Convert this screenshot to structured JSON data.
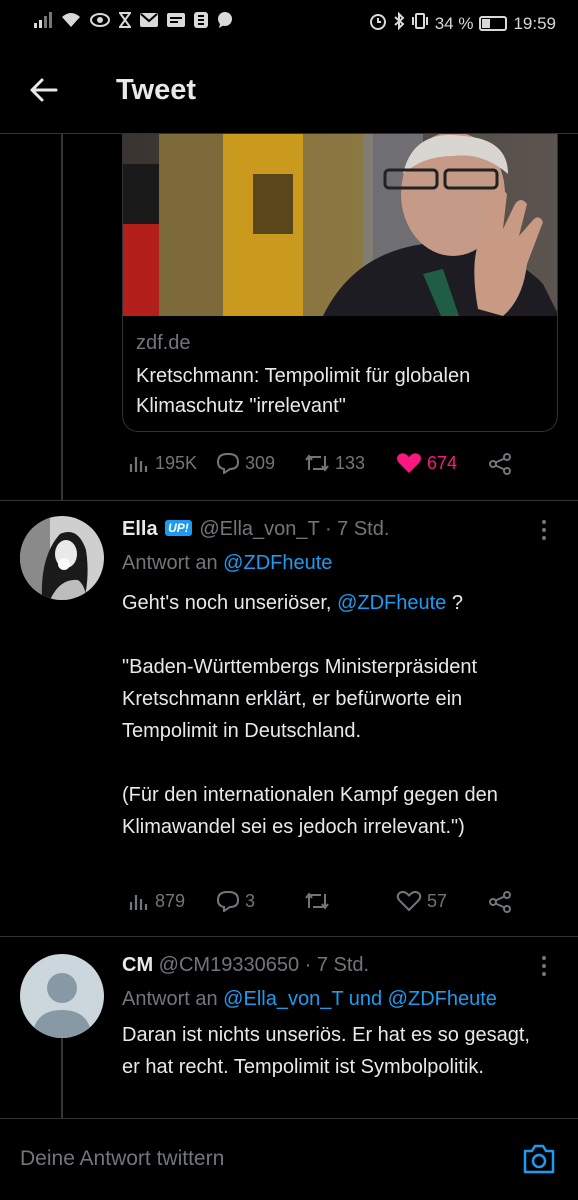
{
  "status_bar": {
    "battery": "34 %",
    "time": "19:59"
  },
  "header": {
    "title": "Tweet"
  },
  "card": {
    "domain": "zdf.de",
    "title": "Kretschmann: Tempolimit für globalen Klimaschutz \"irrelevant\""
  },
  "main_tweet_actions": {
    "views": "195K",
    "replies": "309",
    "retweets": "133",
    "likes": "674",
    "like_color": "#f91880"
  },
  "reply1": {
    "name": "Ella",
    "badge": "UP!",
    "handle": "@Ella_von_T",
    "time": "· 7 Std.",
    "reply_prefix": "Antwort an",
    "reply_to": "@ZDFheute",
    "line1_pre": "Geht's noch unseriöser,",
    "line1_mention": "@ZDFheute",
    "line1_post": "?",
    "para2": "\"Baden-Württembergs Ministerpräsident Kretschmann erklärt, er befürworte ein Tempolimit in Deutschland.",
    "para3": "(Für den internationalen Kampf gegen den Klimawandel sei es jedoch irrelevant.\")",
    "views": "879",
    "replies": "3",
    "retweets": "",
    "likes": "57"
  },
  "reply2": {
    "name": "CM",
    "handle": "@CM19330650",
    "time": "· 7 Std.",
    "reply_prefix": "Antwort an",
    "reply_to_1": "@Ella_von_T",
    "reply_and": "und",
    "reply_to_2": "@ZDFheute",
    "body": "Daran ist nichts unseriös. Er hat es so gesagt, er hat recht. Tempolimit ist Symbolpolitik."
  },
  "composer": {
    "placeholder": "Deine Antwort twittern"
  },
  "colors": {
    "accent": "#1d9bf0",
    "background": "#000000",
    "muted": "#71767b"
  }
}
